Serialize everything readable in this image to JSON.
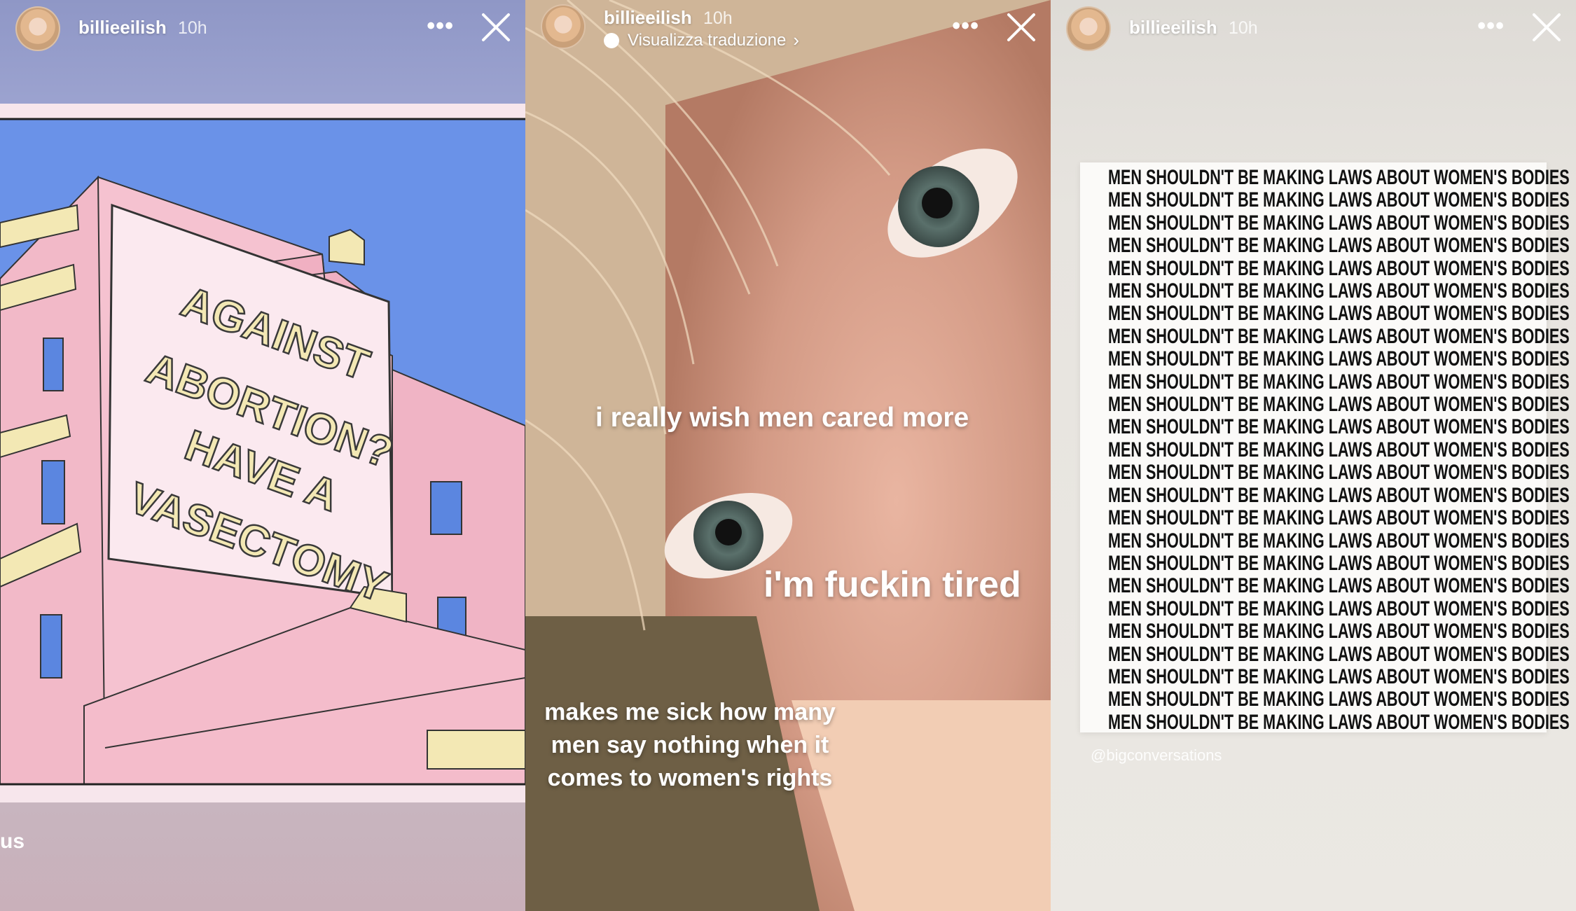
{
  "stories": [
    {
      "username": "billieeilish",
      "time": "10h",
      "mural_text": [
        "AGAINST",
        "ABORTION?",
        "HAVE A",
        "VASECTOMY"
      ],
      "caption_partial": "us"
    },
    {
      "username": "billieeilish",
      "time": "10h",
      "translate_label": "Visualizza traduzione",
      "texts": {
        "line1": "i really wish men cared more",
        "line2": "i'm fuckin tired",
        "line3a": "makes me sick how many",
        "line3b": "men say nothing when it",
        "line3c": "comes to women's rights"
      }
    },
    {
      "username": "billieeilish",
      "time": "10h",
      "poster_line": "MEN SHOULDN'T BE MAKING LAWS ABOUT WOMEN'S BODIES",
      "poster_repeat": 25,
      "credit": "@bigconversations"
    }
  ],
  "icons": {
    "more": "more-dots-icon",
    "close": "close-icon",
    "translate": "translate-bubble-icon",
    "chevron": "chevron-right-icon"
  },
  "colors": {
    "sky": "#6a92e8",
    "building_pink": "#f0b8c8",
    "mural_bg": "#fbe9ef",
    "mural_text": "#f3e8b4"
  }
}
